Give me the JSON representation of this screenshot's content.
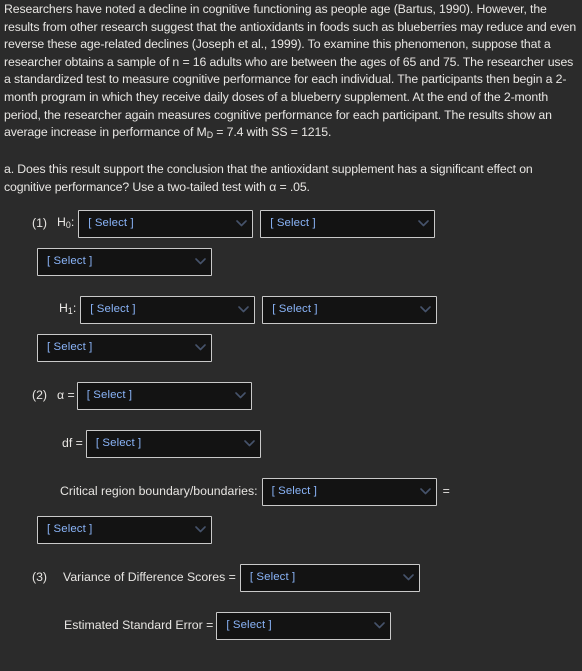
{
  "passage": {
    "text": "Researchers have noted a decline in cognitive functioning as people age (Bartus, 1990). However, the results from other research suggest that the antioxidants in foods such as blueberries may reduce and even reverse these age-related declines (Joseph et al., 1999). To examine this phenomenon, suppose that a researcher obtains a sample of n = 16 adults who are between the ages of 65 and 75. The researcher uses a standardized test to measure cognitive performance for each individual. The participants then begin a 2-month program in which they receive daily doses of a blueberry supplement. At the end of the 2-month period, the researcher again measures cognitive performance for each participant. The results show an average increase in performance of M",
    "m_sub": "D",
    "text_tail": " = 7.4 with SS = 1215."
  },
  "question": {
    "text": "a. Does this result support the conclusion that the antioxidant supplement has a significant effect on cognitive performance? Use a two-tailed test with α = .05."
  },
  "select_placeholder": "[ Select ]",
  "steps": {
    "step1": {
      "number": "(1)",
      "h0_label": "H",
      "h0_sub": "0",
      "h0_colon": ":",
      "h1_label": "H",
      "h1_sub": "1",
      "h1_colon": ":",
      "h0_select_1": "[ Select ]",
      "h0_select_2": "[ Select ]",
      "h0_select_3": "[ Select ]",
      "h1_select_1": "[ Select ]",
      "h1_select_2": "[ Select ]",
      "h1_select_3": "[ Select ]"
    },
    "step2": {
      "number": "(2)",
      "alpha_label": "α =",
      "alpha_select": "[ Select ]",
      "df_label": "df =",
      "df_select": "[ Select ]",
      "critical_label": "Critical region boundary/boundaries:",
      "critical_select": "[ Select ]",
      "critical_equals": "=",
      "critical_select_2": "[ Select ]"
    },
    "step3": {
      "number": "(3)",
      "variance_label": "Variance of Difference Scores =",
      "variance_select": "[ Select ]",
      "sem_label": "Estimated Standard Error =",
      "sem_select": "[ Select ]"
    }
  },
  "colors": {
    "background": "#2b2b2b",
    "text": "#e8e6e3",
    "select_bg": "#131313",
    "select_border": "#c9c9c9",
    "placeholder": "#8ab4f8",
    "chevron": "#46536b"
  },
  "icons": {
    "chevron": "chevron-down-icon"
  }
}
